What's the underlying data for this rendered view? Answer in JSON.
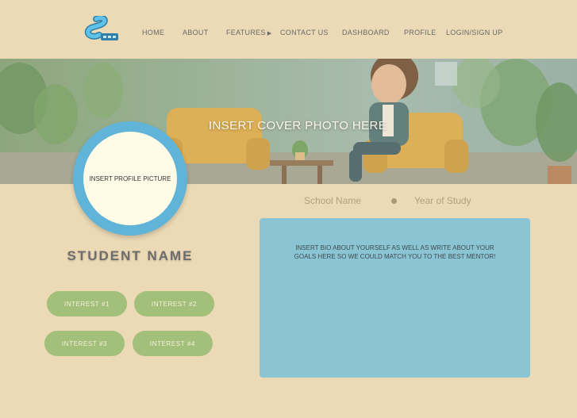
{
  "nav": {
    "logo_icon": "stylized-s-logo-icon",
    "items": [
      {
        "label": "HOME"
      },
      {
        "label": "ABOUT"
      },
      {
        "label": "FEATURES"
      },
      {
        "label": "CONTACT US"
      },
      {
        "label": "DASHBOARD"
      },
      {
        "label": "PROFILE"
      },
      {
        "label": "LOGIN/SIGN UP"
      }
    ],
    "features_arrow_icon": "triangle-right-icon"
  },
  "cover": {
    "text": "INSERT COVER PHOTO HERE"
  },
  "profile": {
    "picture_placeholder": "INSERT PROFILE PICTURE",
    "student_name": "STUDENT NAME",
    "school_name": "School Name",
    "year_of_study": "Year of Study"
  },
  "interests": [
    {
      "label": "INTEREST #1"
    },
    {
      "label": "INTEREST #2"
    },
    {
      "label": "INTEREST #3"
    },
    {
      "label": "INTEREST #4"
    }
  ],
  "bio": {
    "text": "INSERT BIO ABOUT YOURSELF AS WELL AS WRITE ABOUT YOUR\nGOALS HERE SO WE COULD MATCH YOU TO THE BEST MENTOR!"
  },
  "colors": {
    "background": "#ecd9b5",
    "profile_ring": "#5fb4d8",
    "interest_pill": "#a3c07b",
    "bio_box": "#8bc5d3"
  }
}
